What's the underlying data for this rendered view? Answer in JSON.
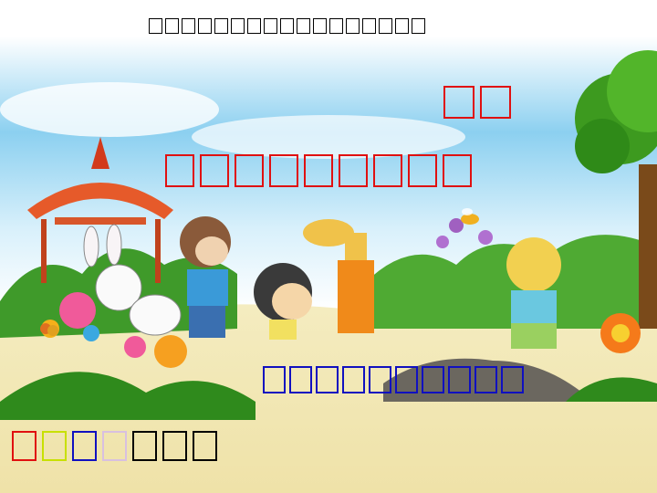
{
  "header_text": "□□□□□□□□□□□□□□□□□",
  "title_text": "□□",
  "subtitle_text": "□□□□□□□□□",
  "blue_text": "□□□□□□□□□□",
  "bottom_text": "□□□□□□□",
  "bottom_colors": [
    "#e01010",
    "#c8e000",
    "#1010c0",
    "#d8c0e0",
    "#000000",
    "#000000",
    "#000000"
  ],
  "colors": {
    "title": "#e01010",
    "subtitle": "#e01010",
    "blue_line": "#1010c0",
    "header": "#000000"
  }
}
